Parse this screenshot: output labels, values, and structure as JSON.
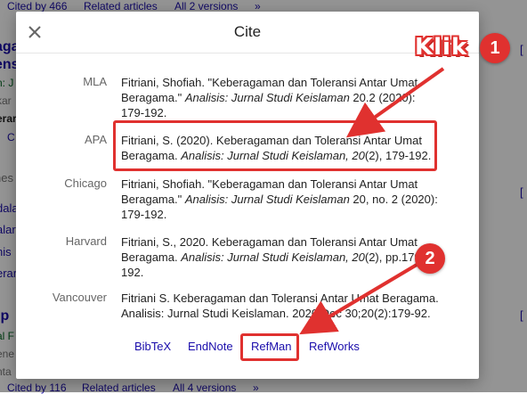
{
  "background": {
    "top_links": [
      "Cited by 466",
      "Related articles",
      "All 2 versions",
      "»"
    ],
    "bottom_links": [
      "Cited by 116",
      "Related articles",
      "All 4 versions",
      "»"
    ],
    "left_fragments": [
      {
        "text": "aga",
        "style": "title"
      },
      {
        "text": "ens",
        "style": "title"
      },
      {
        "text": "n: J",
        "style": "green"
      },
      {
        "text": "kar",
        "style": "gray"
      },
      {
        "text": "erar",
        "style": "darkbold"
      },
      {
        "text": "C",
        "style": "link"
      },
      {
        "text": "nes",
        "style": "gray"
      },
      {
        "text": "dala",
        "style": "link"
      },
      {
        "text": "alar",
        "style": "link"
      },
      {
        "text": "nis",
        "style": "link"
      },
      {
        "text": "erar",
        "style": "link"
      },
      {
        "text": "ip",
        "style": "title"
      },
      {
        "text": "al F",
        "style": "green"
      },
      {
        "text": "ene",
        "style": "gray"
      },
      {
        "text": "nta",
        "style": "gray"
      }
    ],
    "right_fragments": [
      "[",
      "[",
      "["
    ]
  },
  "dialog": {
    "title": "Cite",
    "close_icon": "close-icon",
    "citations": [
      {
        "style": "MLA",
        "pre": "Fitriani, Shofiah. \"Keberagaman dan Toleransi Antar Umat Beragama.\" ",
        "journal": "Analisis: Jurnal Studi Keislaman",
        "post": " 20.2 (2020): 179-192."
      },
      {
        "style": "APA",
        "pre": "Fitriani, S. (2020). Keberagaman dan Toleransi Antar Umat Beragama. ",
        "journal": "Analisis: Jurnal Studi Keislaman, 20",
        "post": "(2), 179-192."
      },
      {
        "style": "Chicago",
        "pre": "Fitriani, Shofiah. \"Keberagaman dan Toleransi Antar Umat Beragama.\" ",
        "journal": "Analisis: Jurnal Studi Keislaman",
        "post": " 20, no. 2 (2020): 179-192."
      },
      {
        "style": "Harvard",
        "pre": "Fitriani, S., 2020. Keberagaman dan Toleransi Antar Umat Beragama. ",
        "journal": "Analisis: Jurnal Studi Keislaman, 20",
        "post": "(2), pp.179-192."
      },
      {
        "style": "Vancouver",
        "pre": "Fitriani S. Keberagaman dan Toleransi Antar Umat Beragama. Analisis: Jurnal Studi Keislaman. 2020 Dec 30;20(2):179-92.",
        "journal": "",
        "post": ""
      }
    ],
    "export_links": [
      "BibTeX",
      "EndNote",
      "RefMan",
      "RefWorks"
    ]
  },
  "annotations": {
    "klik_label": "Klik",
    "badge_1": "1",
    "badge_2": "2",
    "accent_color": "#e0312f"
  }
}
